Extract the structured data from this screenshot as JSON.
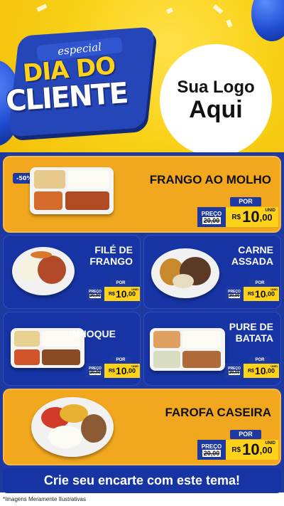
{
  "header": {
    "badge_word": "especial",
    "badge_line1": "DIA DO",
    "badge_line2": "CLIENTE",
    "logo_line1": "Sua Logo",
    "logo_line2": "Aqui"
  },
  "products": [
    {
      "name": "FRANGO AO MOLHO",
      "discount": "-50%",
      "por": "POR",
      "preco": "PREÇO",
      "de": "R$",
      "old_price": "20,00",
      "currency": "R$",
      "price_int": "10",
      "price_dec": ",00",
      "unit": "UNID"
    },
    {
      "name": "FILÉ DE FRANGO",
      "por": "POR",
      "preco": "PREÇO",
      "de": "R$",
      "old_price": "20,00",
      "currency": "R$",
      "price_int": "10",
      "price_dec": ",00",
      "unit": "UNID"
    },
    {
      "name": "CARNE ASSADA",
      "por": "POR",
      "preco": "PREÇO",
      "de": "R$",
      "old_price": "20,00",
      "currency": "R$",
      "price_int": "10",
      "price_dec": ",00",
      "unit": "UNID"
    },
    {
      "name": "NHOQUE",
      "por": "POR",
      "preco": "PREÇO",
      "de": "R$",
      "old_price": "20,00",
      "currency": "R$",
      "price_int": "10",
      "price_dec": ",00",
      "unit": "UNID"
    },
    {
      "name": "PURE DE BATATA",
      "por": "POR",
      "preco": "PREÇO",
      "de": "R$",
      "old_price": "20,00",
      "currency": "R$",
      "price_int": "10",
      "price_dec": ",00",
      "unit": "UNID"
    },
    {
      "name": "FAROFA CASEIRA",
      "por": "POR",
      "preco": "PREÇO",
      "de": "R$",
      "old_price": "20,00",
      "currency": "R$",
      "price_int": "10",
      "price_dec": ",00",
      "unit": "UNID"
    }
  ],
  "cta": "Crie seu encarte com este tema!",
  "footnote": "*Imagens Meramente Ilustrativas",
  "colors": {
    "yellow": "#f2a81e",
    "blue": "#1e3aa0",
    "price_yellow": "#ffd21a"
  }
}
